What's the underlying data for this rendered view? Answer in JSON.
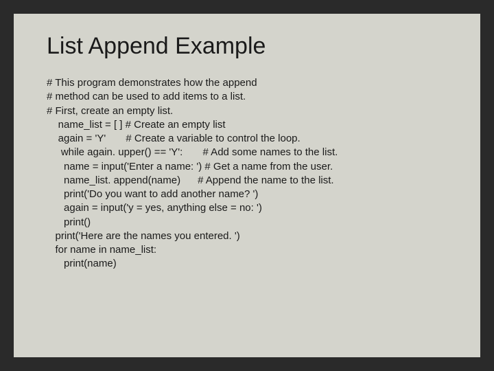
{
  "title": "List Append Example",
  "code": {
    "line1": "# This program demonstrates how the append",
    "line2": "# method can be used to add items to a list.",
    "line3": "# First, create an empty list.",
    "line4": "    name_list = [ ] # Create an empty list",
    "line5": "    again = 'Y'       # Create a variable to control the loop.",
    "line6": "     while again. upper() == 'Y':       # Add some names to the list.",
    "line7": "      name = input('Enter a name: ') # Get a name from the user.",
    "line8": "      name_list. append(name)      # Append the name to the list.",
    "line9": "      print('Do you want to add another name? ')",
    "line10": "      again = input('y = yes, anything else = no: ')",
    "line11": "      print()",
    "line12": "   print('Here are the names you entered. ')",
    "line13": "   for name in name_list:",
    "line14": "      print(name)"
  }
}
